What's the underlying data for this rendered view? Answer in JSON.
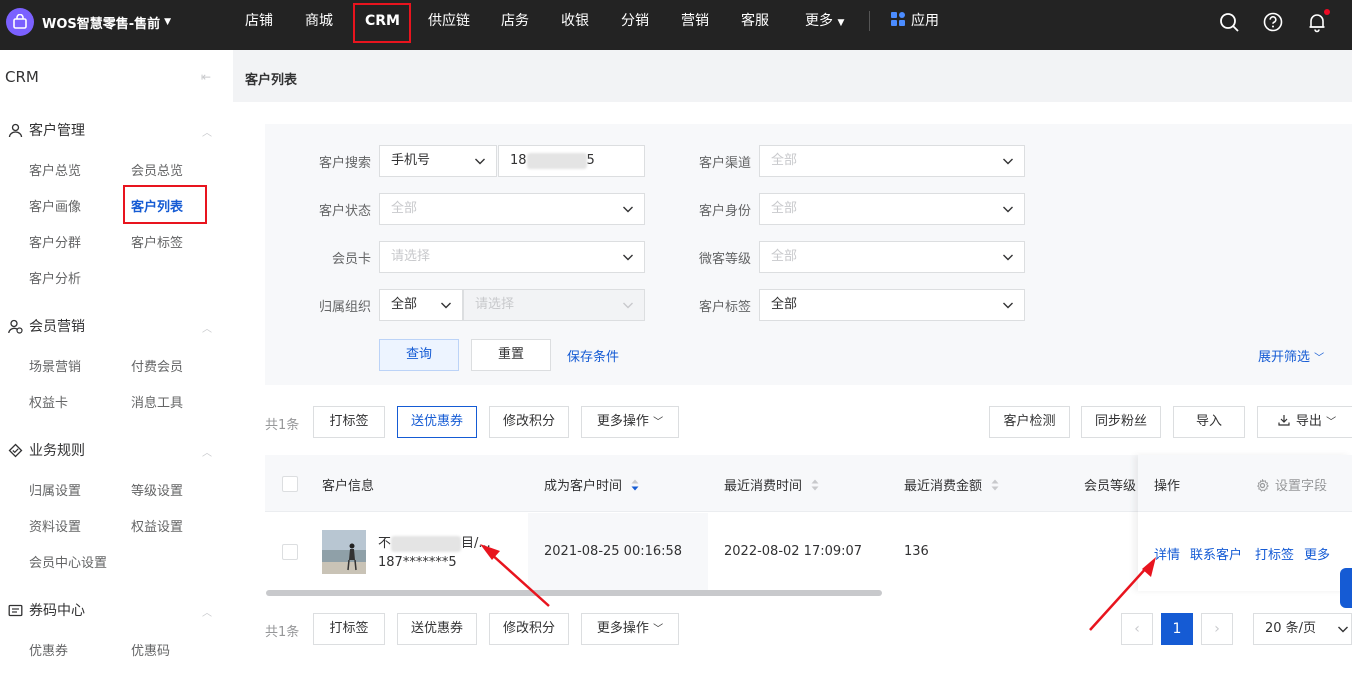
{
  "topnav": {
    "brand": "WOS智慧零售-售前",
    "items": [
      "店铺",
      "商城",
      "CRM",
      "供应链",
      "店务",
      "收银",
      "分销",
      "营销",
      "客服",
      "更多"
    ],
    "apps": "应用",
    "icons": [
      "search-icon",
      "help-icon",
      "bell-icon"
    ]
  },
  "sidebar": {
    "title": "CRM",
    "groups": [
      {
        "label": "客户管理",
        "icon": "user-icon",
        "items": [
          "客户总览",
          "会员总览",
          "客户画像",
          "客户列表",
          "客户分群",
          "客户标签",
          "客户分析"
        ]
      },
      {
        "label": "会员营销",
        "icon": "member-icon",
        "items": [
          "场景营销",
          "付费会员",
          "权益卡",
          "消息工具"
        ]
      },
      {
        "label": "业务规则",
        "icon": "rule-icon",
        "items": [
          "归属设置",
          "等级设置",
          "资料设置",
          "权益设置",
          "会员中心设置"
        ]
      },
      {
        "label": "券码中心",
        "icon": "coupon-icon",
        "items": [
          "优惠券",
          "优惠码"
        ]
      }
    ]
  },
  "page": {
    "title": "客户列表"
  },
  "filters": {
    "search_label": "客户搜索",
    "search_type": "手机号",
    "search_value_prefix": "18",
    "search_value_suffix": "5",
    "channel_label": "客户渠道",
    "status_label": "客户状态",
    "identity_label": "客户身份",
    "card_label": "会员卡",
    "card_placeholder": "请选择",
    "wechat_level_label": "微客等级",
    "org_label": "归属组织",
    "org_value": "全部",
    "org_placeholder": "请选择",
    "tag_label": "客户标签",
    "all": "全部",
    "query": "查询",
    "reset": "重置",
    "save": "保存条件",
    "expand": "展开筛选"
  },
  "toolbar": {
    "count": "共1条",
    "tag": "打标签",
    "coupon": "送优惠券",
    "points": "修改积分",
    "more_ops": "更多操作",
    "detect": "客户检测",
    "sync_fans": "同步粉丝",
    "import": "导入",
    "export": "导出"
  },
  "table": {
    "columns": [
      "客户信息",
      "成为客户时间",
      "最近消费时间",
      "最近消费金额",
      "会员等级",
      "操作"
    ],
    "settings": "设置字段",
    "rows": [
      {
        "name_prefix": "不",
        "name_suffix": "目/...",
        "phone": "187*******5",
        "became_time": "2021-08-25 00:16:58",
        "last_consume_time": "2022-08-02 17:09:07",
        "last_consume_amount": "136",
        "actions": [
          "详情",
          "联系客户",
          "打标签",
          "更多"
        ]
      }
    ]
  },
  "pager": {
    "current": "1",
    "page_size": "20 条/页"
  }
}
